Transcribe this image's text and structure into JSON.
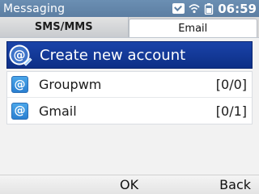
{
  "status": {
    "title": "Messaging",
    "time": "06:59",
    "icons": [
      "message-indicator-icon",
      "wifi-icon",
      "battery-icon"
    ],
    "bar_color": "#5c7ea2"
  },
  "tabs": [
    {
      "label": "SMS/MMS",
      "selected": false
    },
    {
      "label": "Email",
      "selected": true
    }
  ],
  "create": {
    "label": "Create new account",
    "icon": "email-add-icon",
    "color": "#0d2f86"
  },
  "accounts": [
    {
      "name": "Groupwm",
      "count": "[0/0]",
      "icon": "at-sign-icon"
    },
    {
      "name": "Gmail",
      "count": "[0/1]",
      "icon": "at-sign-icon"
    }
  ],
  "softkeys": {
    "left": "",
    "center": "OK",
    "right": "Back"
  }
}
